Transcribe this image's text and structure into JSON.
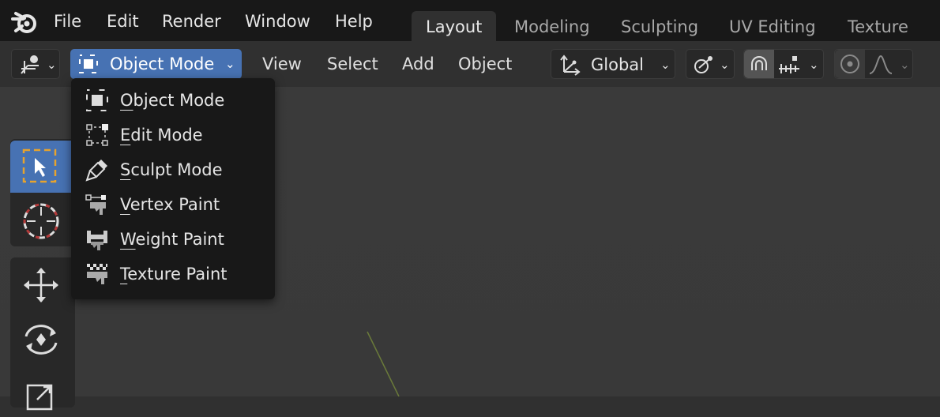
{
  "topbar": {
    "menus": [
      "File",
      "Edit",
      "Render",
      "Window",
      "Help"
    ],
    "workspaces": [
      {
        "label": "Layout",
        "active": true
      },
      {
        "label": "Modeling",
        "active": false
      },
      {
        "label": "Sculpting",
        "active": false
      },
      {
        "label": "UV Editing",
        "active": false
      },
      {
        "label": "Texture Pa",
        "active": false
      }
    ]
  },
  "header": {
    "mode_label": "Object Mode",
    "menus": [
      "View",
      "Select",
      "Add",
      "Object"
    ],
    "orientation_label": "Global"
  },
  "dropdown": {
    "items": [
      {
        "first": "O",
        "rest": "bject Mode"
      },
      {
        "first": "E",
        "rest": "dit Mode"
      },
      {
        "first": "S",
        "rest": "culpt Mode"
      },
      {
        "first": "V",
        "rest": "ertex Paint"
      },
      {
        "first": "W",
        "rest": "eight Paint"
      },
      {
        "first": "T",
        "rest": "exture Paint"
      }
    ]
  },
  "colors": {
    "accent": "#4772b3",
    "topbar_bg": "#181818",
    "viewport_bg": "#393939",
    "select_box": "#e6a32e"
  }
}
